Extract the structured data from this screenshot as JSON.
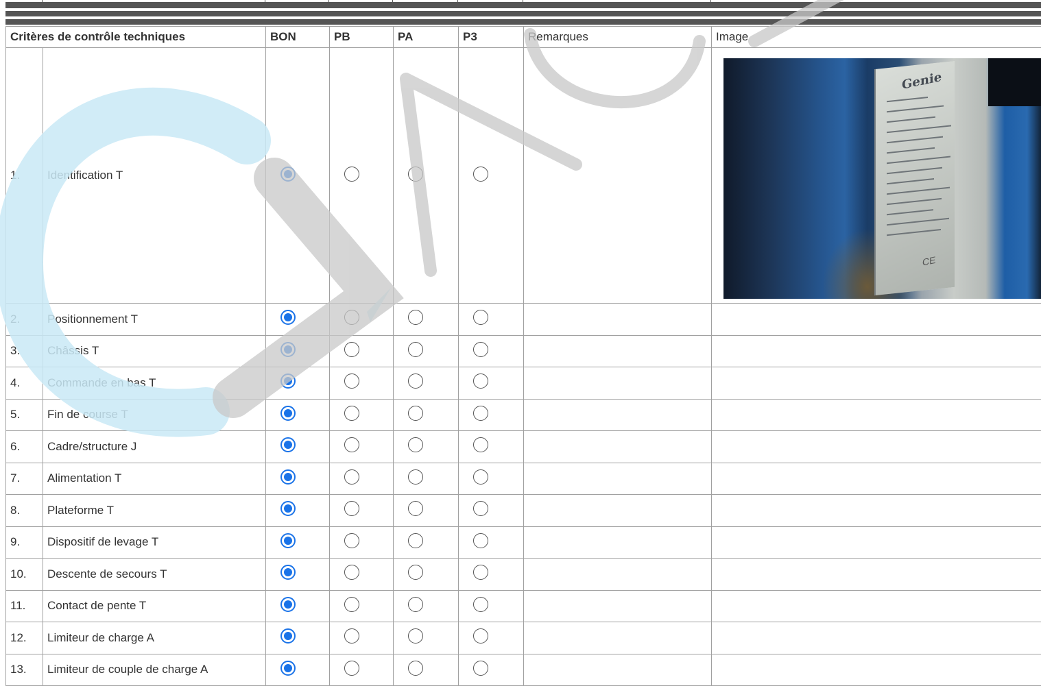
{
  "table": {
    "headers": {
      "criteria": "Critères de contrôle techniques",
      "bon": "BON",
      "pb": "PB",
      "pa": "PA",
      "p3": "P3",
      "remarks": "Remarques",
      "image": "Image"
    },
    "rows": [
      {
        "num": "1.",
        "label": "Identification T",
        "selected": "BON",
        "remarks": ""
      },
      {
        "num": "2.",
        "label": "Positionnement T",
        "selected": "BON",
        "remarks": ""
      },
      {
        "num": "3.",
        "label": "Châssis T",
        "selected": "BON",
        "remarks": ""
      },
      {
        "num": "4.",
        "label": "Commande en bas T",
        "selected": "BON",
        "remarks": ""
      },
      {
        "num": "5.",
        "label": "Fin de course T",
        "selected": "BON",
        "remarks": ""
      },
      {
        "num": "6.",
        "label": "Cadre/structure J",
        "selected": "BON",
        "remarks": ""
      },
      {
        "num": "7.",
        "label": "Alimentation T",
        "selected": "BON",
        "remarks": ""
      },
      {
        "num": "8.",
        "label": "Plateforme T",
        "selected": "BON",
        "remarks": ""
      },
      {
        "num": "9.",
        "label": "Dispositif de levage T",
        "selected": "BON",
        "remarks": ""
      },
      {
        "num": "10.",
        "label": "Descente de secours T",
        "selected": "BON",
        "remarks": ""
      },
      {
        "num": "11.",
        "label": "Contact de pente T",
        "selected": "BON",
        "remarks": ""
      },
      {
        "num": "12.",
        "label": "Limiteur de charge A",
        "selected": "BON",
        "remarks": ""
      },
      {
        "num": "13.",
        "label": "Limiteur de couple de charge A",
        "selected": "BON",
        "remarks": ""
      }
    ],
    "photo": {
      "brand_text": "Genie",
      "mark": "CE"
    }
  },
  "colors": {
    "radio_selected": "#1a73e8",
    "watermark_cyan": "#c9e9f6",
    "watermark_gray": "#c8c8c8"
  }
}
